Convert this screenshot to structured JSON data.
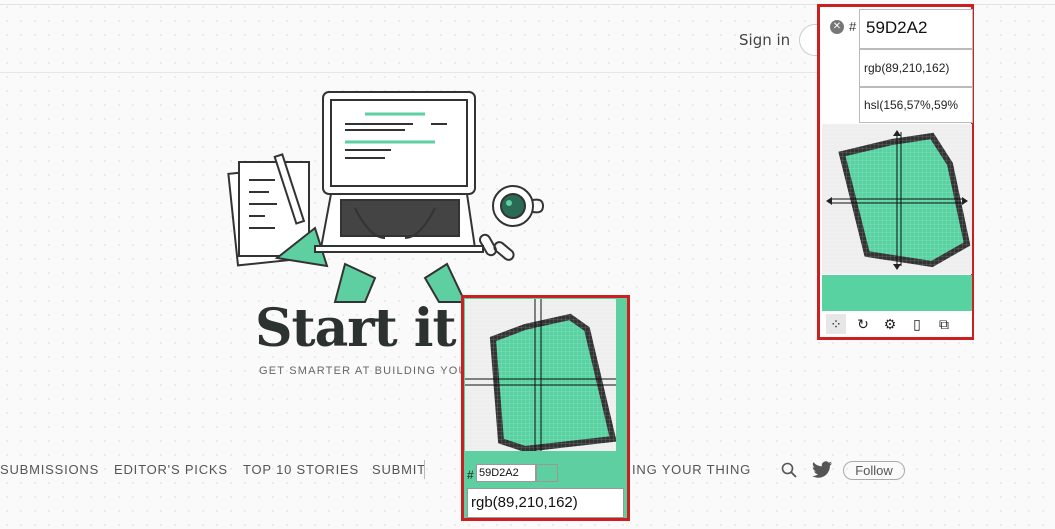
{
  "header": {
    "signin_label": "Sign in"
  },
  "publication": {
    "name": "Start it u",
    "tagline": "GET SMARTER AT BUILDING YOU"
  },
  "nav": {
    "items": [
      "SUBMISSIONS",
      "EDITOR'S PICKS",
      "TOP 10 STORIES",
      "SUBMIT"
    ],
    "hidden_item_partial": "ING YOUR THING",
    "follow_label": "Follow"
  },
  "picker": {
    "hash": "#",
    "hex": "59D2A2",
    "rgb": "rgb(89,210,162)",
    "hsl": "hsl(156,57%,59%",
    "sampled_color": "#59D2A2",
    "tools": [
      "eyedropper-icon",
      "refresh-icon",
      "gear-icon",
      "phone-icon",
      "popout-icon"
    ]
  },
  "magnifier": {
    "hash": "#",
    "hex": "59D2A2",
    "rgb": "rgb(89,210,162)"
  },
  "colors": {
    "accent": "#5ecfa0",
    "frame": "#cc1f1f",
    "ink": "#2c3230"
  }
}
